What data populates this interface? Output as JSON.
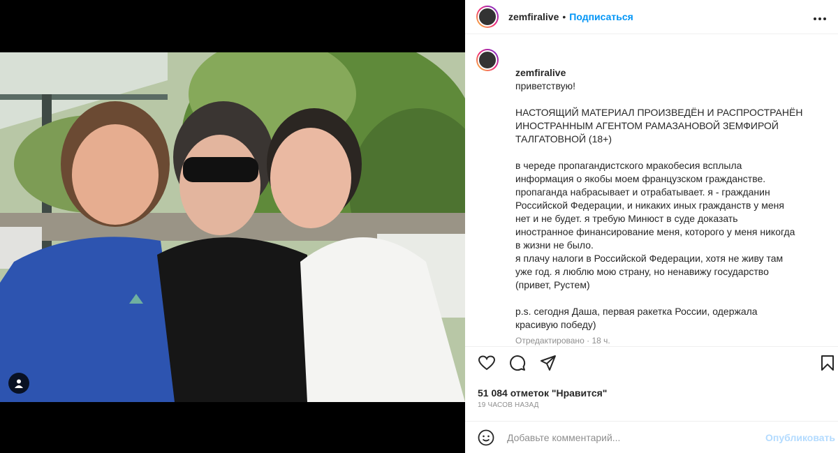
{
  "post": {
    "username": "zemfiralive",
    "follow_label": "Подписаться",
    "more_icon": "more-dots-icon"
  },
  "caption": {
    "username": "zemfiralive",
    "greeting": "приветствую!",
    "paragraph1": "НАСТОЯЩИЙ МАТЕРИАЛ ПРОИЗВЕДЁН И РАСПРОСТРАНЁН\nИНОСТРАННЫМ АГЕНТОМ РАМАЗАНОВОЙ ЗЕМФИРОЙ\nТАЛГАТОВНОЙ (18+)",
    "paragraph2": "в череде пропагандистского мракобесия всплыла\nинформация о якобы моем французском гражданстве.\nпропаганда набрасывает и отрабатывает. я - гражданин\nРоссийской Федерации, и никаких иных гражданств у меня\nнет и не будет. я требую Минюст в суде доказать\nиностранное финансирование меня, которого у меня никогда\nв жизни не было.\nя плачу налоги в Российской Федерации, хотя не живу там\nуже год. я люблю мою страну, но ненавижу государство\n(привет, Рустем)",
    "paragraph3": "p.s. сегодня Даша, первая ракетка России, одержала\nкрасивую победу)",
    "edited": "Отредактировано",
    "edited_time": "18 ч."
  },
  "actions": {
    "like_icon": "heart-icon",
    "comment_icon": "comment-icon",
    "share_icon": "share-icon",
    "save_icon": "bookmark-icon"
  },
  "likes_text": "51 084 отметок \"Нравится\"",
  "timestamp": "19 ЧАСОВ НАЗАД",
  "comment": {
    "placeholder": "Добавьте комментарий...",
    "publish_label": "Опубликовать",
    "emoji_icon": "emoji-icon"
  },
  "colors": {
    "link": "#0095f6",
    "publish_disabled": "#b3dbff",
    "text": "#262626",
    "muted": "#8e8e8e"
  }
}
